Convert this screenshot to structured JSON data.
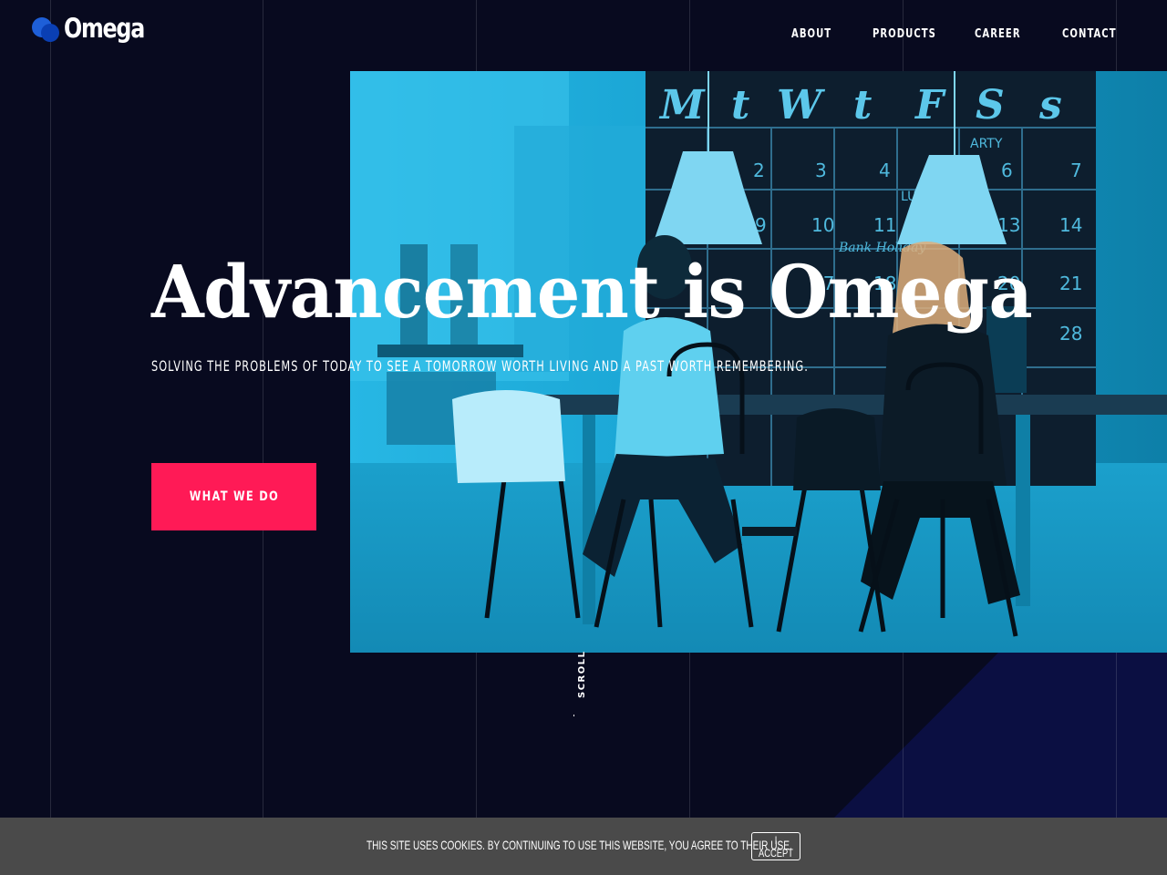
{
  "brand": {
    "name": "Omega",
    "colors": {
      "background": "#080a1f",
      "accent": "#ff1a56",
      "logo_blue": "#1e5fd8",
      "photo_tint": "#1aa1ce"
    }
  },
  "nav": {
    "items": [
      {
        "label": "ABOUT"
      },
      {
        "label": "PRODUCTS"
      },
      {
        "label": "CAREER"
      },
      {
        "label": "CONTACT"
      }
    ]
  },
  "hero": {
    "title": "Advancement is Omega",
    "subtitle": "SOLVING THE PROBLEMS OF TODAY TO SEE A TOMORROW WORTH LIVING AND A PAST WORTH REMEMBERING.",
    "cta_label": "WHAT WE DO",
    "scroll_label": "SCROLL",
    "photo": {
      "description_icon": "office-photo",
      "calendar_days": [
        "M",
        "t",
        "W",
        "t",
        "F",
        "S",
        "s"
      ],
      "calendar_notes": [
        "ARTY",
        "LUN",
        "Bank Holiday"
      ],
      "calendar_numbers": [
        "2",
        "3",
        "4",
        "6",
        "7",
        "9",
        "10",
        "11",
        "13",
        "14",
        "17",
        "18",
        "20",
        "21",
        "28"
      ]
    }
  },
  "cookie": {
    "text": "THIS SITE USES COOKIES. BY CONTINUING TO USE THIS WEBSITE, YOU AGREE TO THEIR USE.",
    "button_label": "I ACCEPT"
  }
}
